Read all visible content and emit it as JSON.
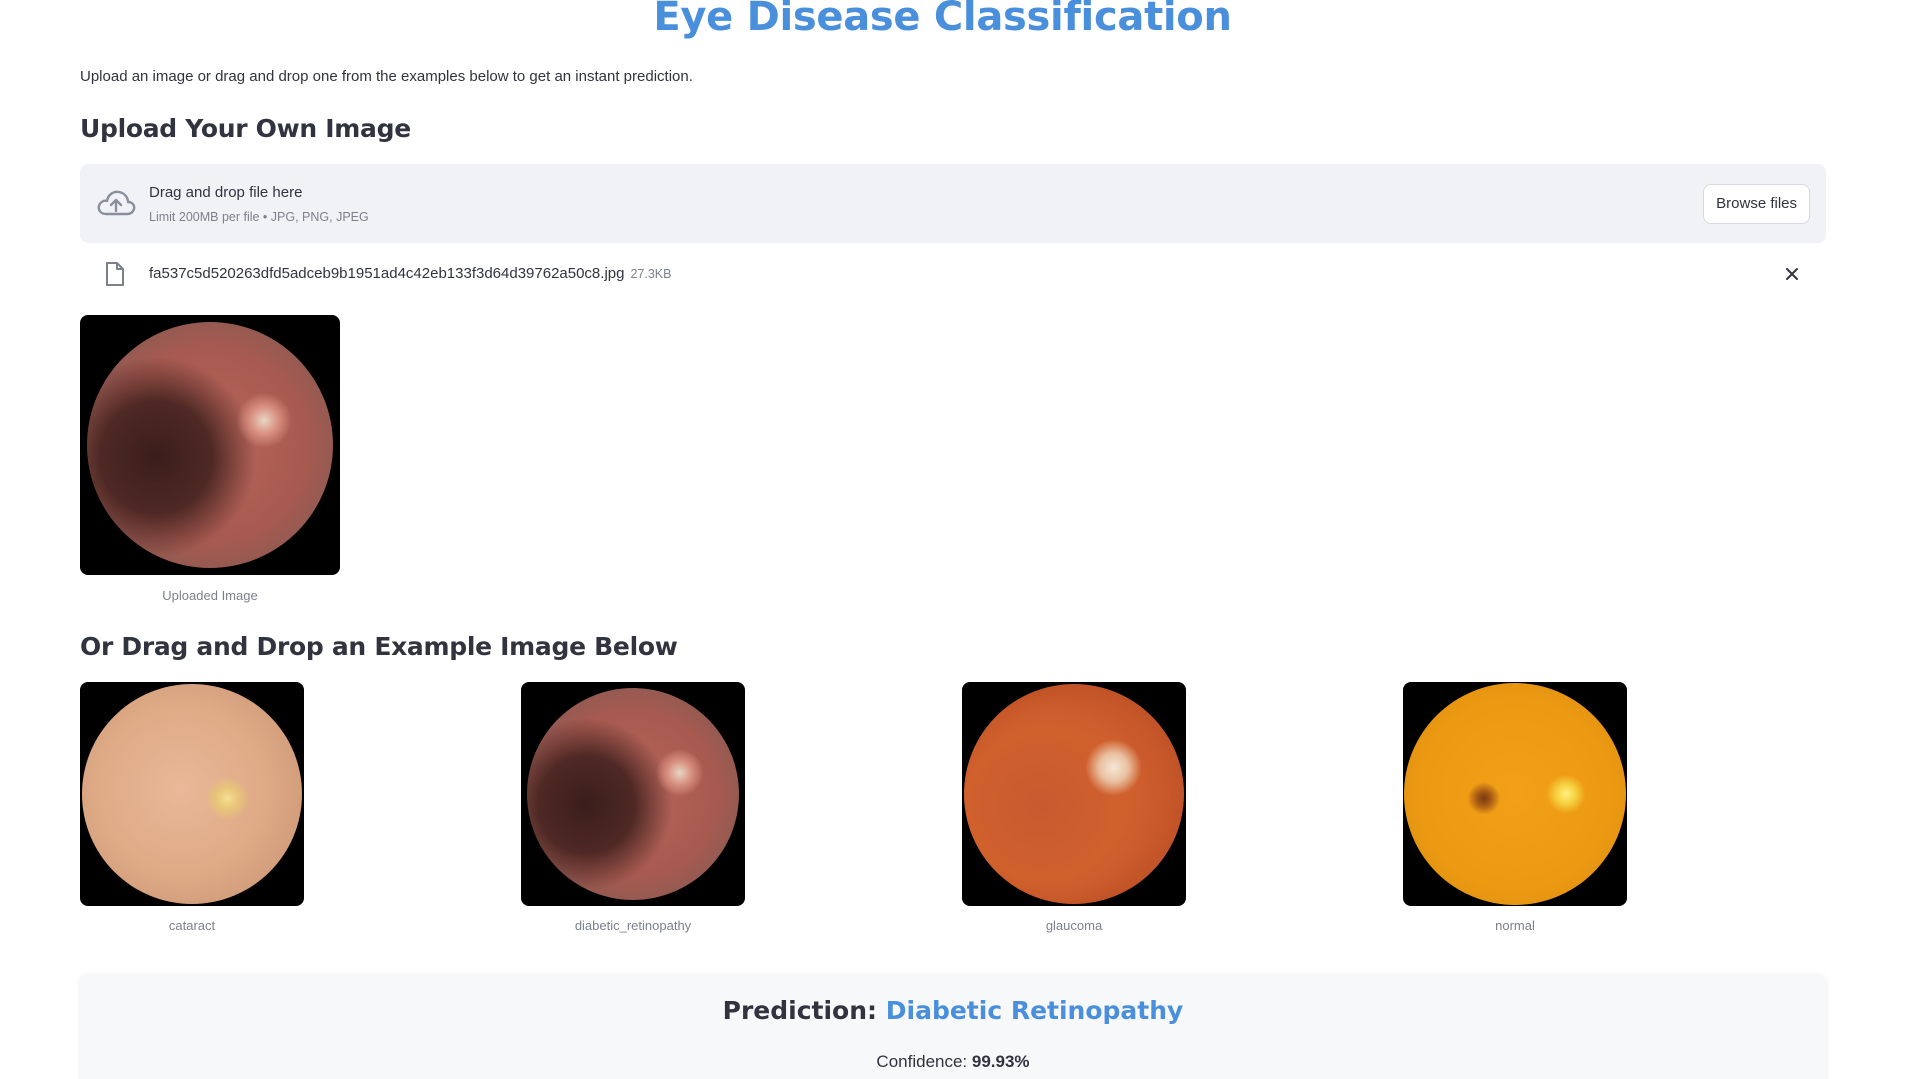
{
  "app": {
    "title": "Eye Disease Classification",
    "intro": "Upload an image or drag and drop one from the examples below to get an instant prediction.",
    "accent_color": "#4a8fdc"
  },
  "upload": {
    "heading": "Upload Your Own Image",
    "dropzone": {
      "icon": "cloud-upload-icon",
      "main_text": "Drag and drop file here",
      "sub_text": "Limit 200MB per file • JPG, PNG, JPEG",
      "browse_label": "Browse files"
    },
    "file": {
      "icon": "file-icon",
      "name": "fa537c5d520263dfd5adceb9b1951ad4c42eb133f3d64d39762a50c8.jpg",
      "size": "27.3KB"
    },
    "uploaded_caption": "Uploaded Image"
  },
  "examples": {
    "heading": "Or Drag and Drop an Example Image Below",
    "items": [
      {
        "caption": "cataract"
      },
      {
        "caption": "diabetic_retinopathy"
      },
      {
        "caption": "glaucoma"
      },
      {
        "caption": "normal"
      }
    ]
  },
  "result": {
    "prediction_label": "Prediction:",
    "prediction_value": "Diabetic Retinopathy",
    "confidence_label": "Confidence:",
    "confidence_value": "99.93%"
  }
}
